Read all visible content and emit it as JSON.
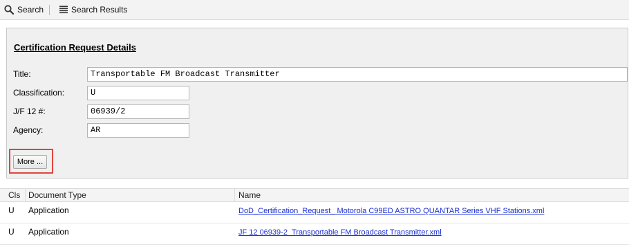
{
  "toolbar": {
    "search_label": "Search",
    "results_label": "Search Results"
  },
  "details": {
    "heading": "Certification Request Details",
    "fields": {
      "title": {
        "label": "Title:",
        "value": "Transportable FM Broadcast Transmitter"
      },
      "classification": {
        "label": "Classification:",
        "value": "U"
      },
      "jf12": {
        "label": "J/F 12 #:",
        "value": "06939/2"
      },
      "agency": {
        "label": "Agency:",
        "value": "AR"
      }
    },
    "more_label": "More ...",
    "highlight_color": "#e0453e"
  },
  "table": {
    "columns": [
      "Cls",
      "Document Type",
      "Name"
    ],
    "rows": [
      {
        "cls": "U",
        "doc_type": "Application",
        "name": "DoD_Certification_Request_ Motorola C99ED ASTRO QUANTAR Series VHF Stations.xml"
      },
      {
        "cls": "U",
        "doc_type": "Application",
        "name": "JF 12 06939-2_Transportable FM Broadcast Transmitter.xml"
      }
    ]
  }
}
